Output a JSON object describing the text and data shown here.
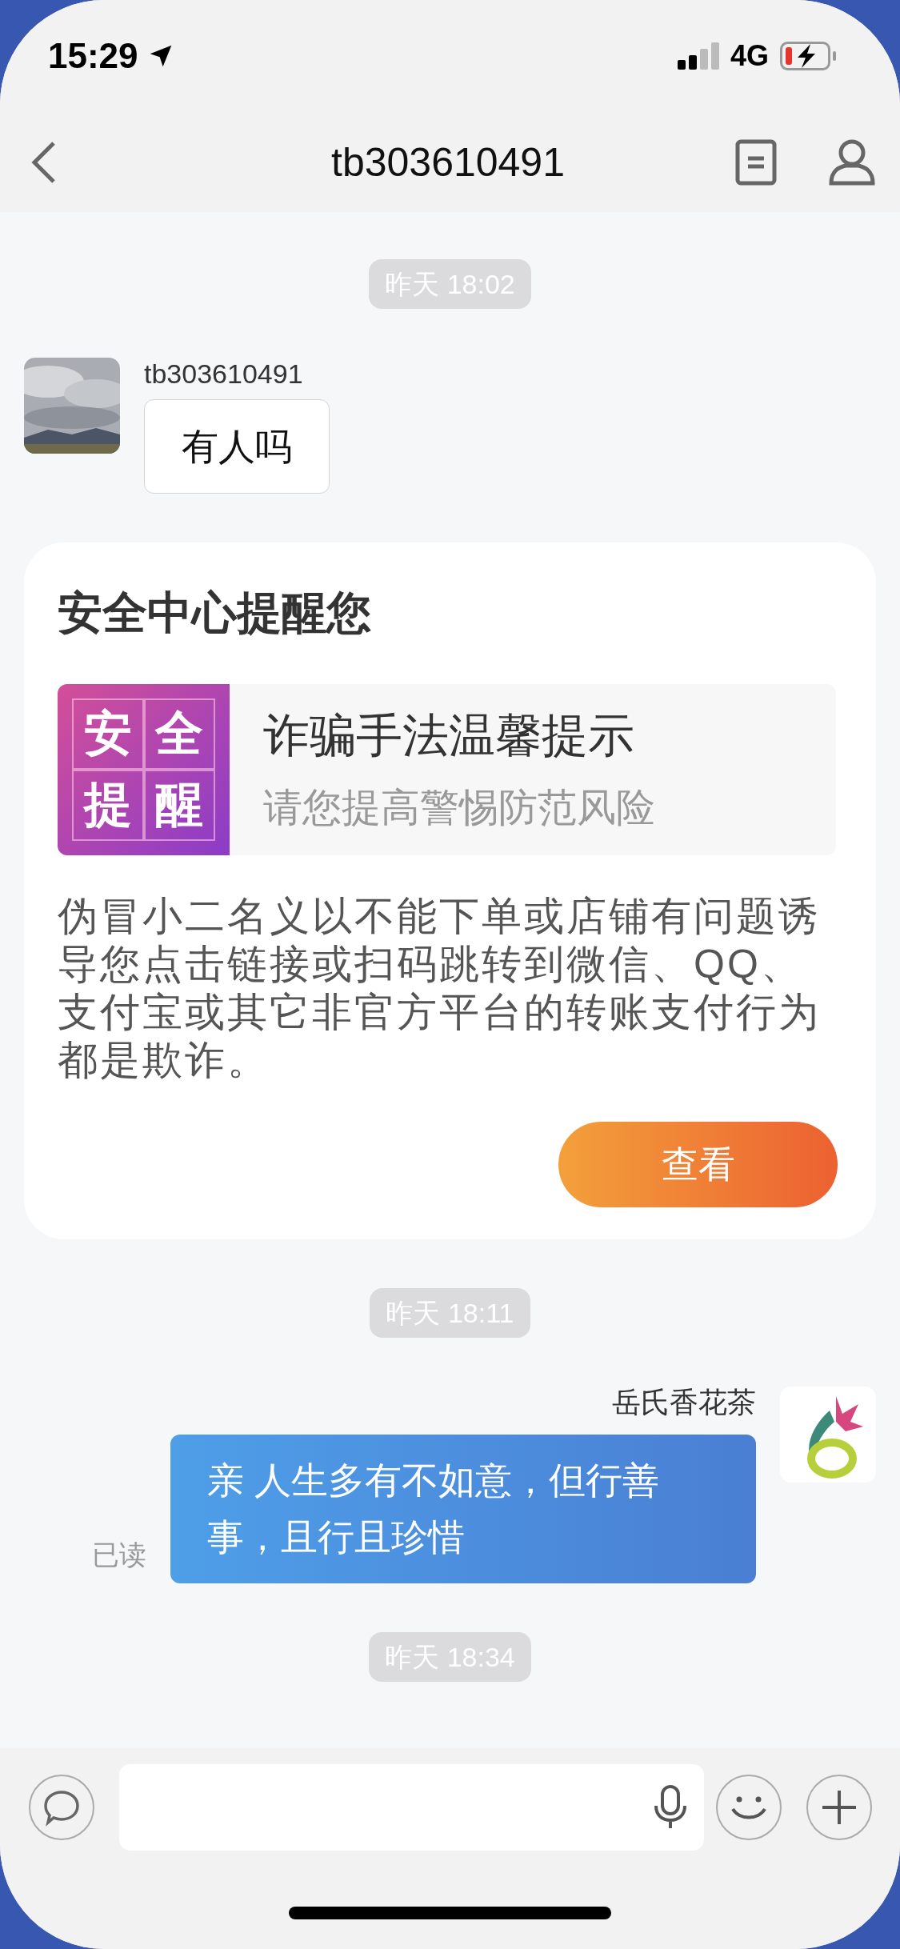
{
  "status_bar": {
    "time": "15:29",
    "network": "4G"
  },
  "nav": {
    "title": "tb303610491"
  },
  "messages": [
    {
      "kind": "time",
      "text": "昨天 18:02"
    },
    {
      "kind": "incoming",
      "sender": "tb303610491",
      "text": "有人吗"
    },
    {
      "kind": "security_card",
      "title": "安全中心提醒您",
      "badge_chars": [
        "安",
        "全",
        "提",
        "醒"
      ],
      "headline": "诈骗手法温馨提示",
      "subline": "请您提高警惕防范风险",
      "body": "伪冒小二名义以不能下单或店铺有问题诱导您点击链接或扫码跳转到微信、QQ、支付宝或其它非官方平台的转账支付行为都是欺诈。",
      "button": "查看"
    },
    {
      "kind": "time",
      "text": "昨天 18:11"
    },
    {
      "kind": "outgoing",
      "sender": "岳氏香花茶",
      "text": "亲 人生多有不如意，但行善事，且行且珍惜",
      "receipt": "已读"
    },
    {
      "kind": "time",
      "text": "昨天 18:34"
    }
  ]
}
